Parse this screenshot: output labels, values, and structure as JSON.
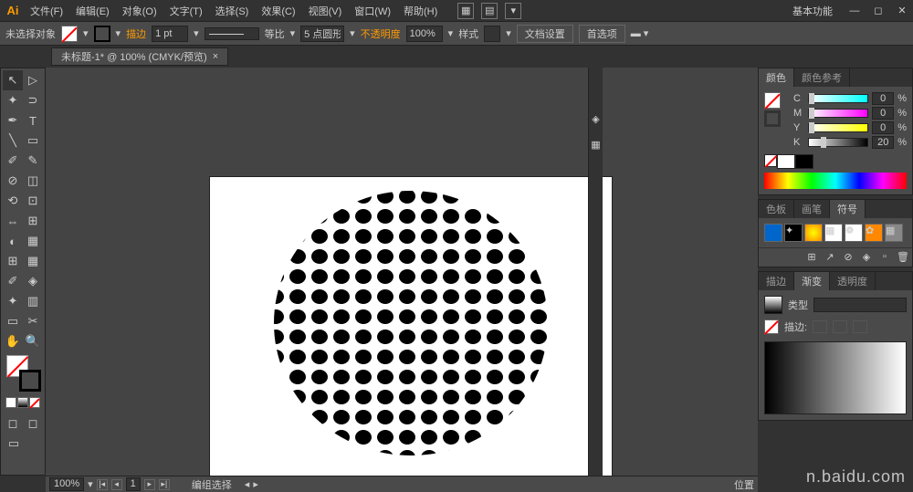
{
  "app": {
    "logo": "Ai"
  },
  "menu": {
    "file": "文件(F)",
    "edit": "编辑(E)",
    "object": "对象(O)",
    "text": "文字(T)",
    "select": "选择(S)",
    "effect": "效果(C)",
    "view": "视图(V)",
    "window": "窗口(W)",
    "help": "帮助(H)"
  },
  "workspace": "基本功能",
  "controlbar": {
    "no_selection": "未选择对象",
    "stroke": "描边",
    "stroke_width": "1 pt",
    "dash_label": "等比",
    "dash_value": "5 点圆形",
    "opacity": "不透明度",
    "opacity_value": "100%",
    "style": "样式",
    "doc_setup": "文档设置",
    "preferences": "首选项"
  },
  "tab": {
    "title": "未标题-1* @ 100% (CMYK/预览)",
    "close": "×"
  },
  "tools": [
    [
      "↖",
      "✦"
    ],
    [
      "✎",
      "T"
    ],
    [
      "╱",
      "▭"
    ],
    [
      "✐",
      "✎"
    ],
    [
      "⟲",
      "⊞"
    ],
    [
      "◐",
      "⊗"
    ],
    [
      "⇄",
      "◫"
    ],
    [
      "⊕",
      "✂"
    ],
    [
      "⊞",
      "▦"
    ],
    [
      "⇗",
      "◈"
    ],
    [
      "✋",
      "🔍"
    ]
  ],
  "bottom": {
    "zoom": "100%",
    "page": "1",
    "status": "编组选择"
  },
  "color_panel": {
    "tab1": "颜色",
    "tab2": "颜色参考",
    "c": "C",
    "m": "M",
    "y": "Y",
    "k": "K",
    "c_val": "0",
    "m_val": "0",
    "y_val": "0",
    "k_val": "20",
    "pct": "%"
  },
  "swatch_panel": {
    "tab1": "色板",
    "tab2": "画笔",
    "tab3": "符号"
  },
  "gradient_panel": {
    "tab1": "描边",
    "tab2": "渐变",
    "tab3": "透明度",
    "type": "类型",
    "stroke": "描边:"
  },
  "watermark": "n.baidu.com",
  "last_panel": "位置"
}
